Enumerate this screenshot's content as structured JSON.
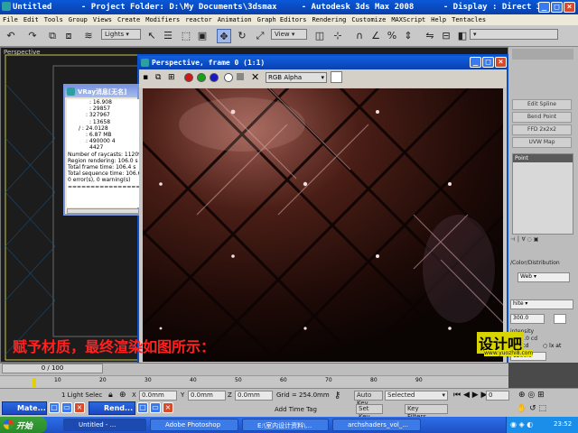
{
  "window": {
    "title": "Untitled      - Project Folder: D:\\My Documents\\3dsmax     - Autodesk 3ds Max 2008      - Display : Direct 3D",
    "minimize": "_",
    "maximize": "□",
    "close": "×"
  },
  "menu": [
    "File",
    "Edit",
    "Tools",
    "Group",
    "Views",
    "Create",
    "Modifiers",
    "reactor",
    "Animation",
    "Graph Editors",
    "Rendering",
    "Customize",
    "MAXScript",
    "Help",
    "Tentacles"
  ],
  "toolbar": {
    "selection_filter": "Lights",
    "ref_coord": "View"
  },
  "viewport": {
    "label": "Perspective"
  },
  "command_panel": {
    "buttons": [
      "Edit Spline",
      "Bend Point",
      "FFD 2x2x2",
      "UVW Map"
    ],
    "list_header": "Point",
    "distribution_label": "/Color/Distribution",
    "web_option": "Web",
    "white_option": "hite",
    "value_field": "300.0",
    "intensity_label": "intensity",
    "intensity_value": "1200.0 cd",
    "cd_label": "cd",
    "lx_label": "lx at",
    "spinner_value": "1200.0"
  },
  "render_window": {
    "title": "Perspective, frame 0 (1:1)",
    "channel": "RGB Alpha"
  },
  "vray_dialog": {
    "title": "VRay消息[无名]",
    "lines": [
      ": 16.908",
      ": 29857",
      ": 327967",
      ": 13658",
      "/    : 24.0128",
      ": 6.87 MB",
      ": 490000    4",
      "4427",
      "Number of raycasts: 112096",
      "Region rendering: 106.0 s",
      "Total frame time: 106.4 s",
      "Total sequence time: 106.6",
      "0 error(s), 0 warning(s)",
      "======================="
    ]
  },
  "caption": "赋予材质，最终渲染如图所示：",
  "timeline": {
    "position": "0 / 100",
    "ticks": [
      "10",
      "20",
      "30",
      "40",
      "50",
      "60",
      "70",
      "80",
      "90"
    ]
  },
  "status": {
    "selection": "1 Light Selec",
    "x_label": "X",
    "x_value": "0.0mm",
    "y_label": "Y",
    "y_value": "0.0mm",
    "z_label": "Z",
    "z_value": "0.0mm",
    "grid": "Grid = 254.0mm",
    "auto_key": "Auto Key",
    "selected": "Selected",
    "set_key": "Set Key",
    "key_filters": "Key Filters...",
    "add_time_tag": "Add Time Tag",
    "frame_field": "0",
    "mini_windows": [
      "Mate...",
      "Rend..."
    ]
  },
  "watermark": "设计吧",
  "watermark_url": "www.yuozhi8.com",
  "taskbar": {
    "start": "开始",
    "tasks": [
      "Untitled       - ...",
      "Adobe Photoshop",
      "E:\\室内设计资料\\...",
      "archshaders_vol_..."
    ],
    "time": "23:52"
  },
  "colors": {
    "titlebar_blue": "#0a50c8",
    "caption_red": "#ff2020",
    "render_bg": "#140806"
  }
}
